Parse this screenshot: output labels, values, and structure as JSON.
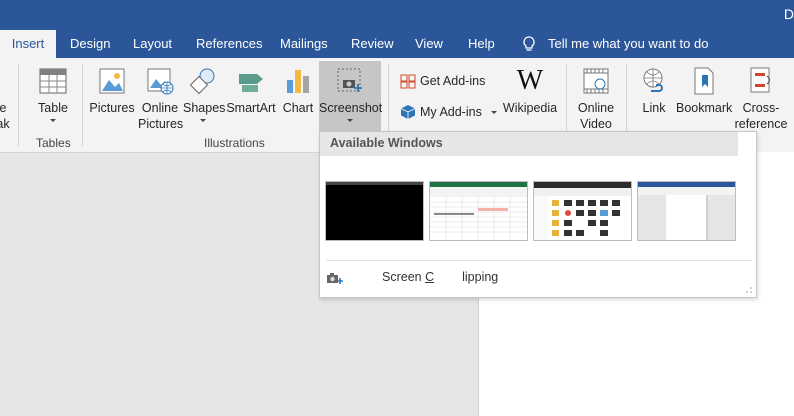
{
  "window": {
    "title_fragment": "D"
  },
  "tabs": [
    {
      "label": "Insert",
      "active": true
    },
    {
      "label": "Design"
    },
    {
      "label": "Layout"
    },
    {
      "label": "References"
    },
    {
      "label": "Mailings"
    },
    {
      "label": "Review"
    },
    {
      "label": "View"
    },
    {
      "label": "Help"
    }
  ],
  "tellme": "Tell me what you want to do",
  "ribbon": {
    "clipped_left": {
      "line1": "e",
      "line2": "ak"
    },
    "table": {
      "label": "Table"
    },
    "groups": {
      "tables": "Tables",
      "illustrations": "Illustrations"
    },
    "pictures": "Pictures",
    "online_pictures": {
      "line1": "Online",
      "line2": "Pictures"
    },
    "shapes": "Shapes",
    "smartart": "SmartArt",
    "chart": "Chart",
    "screenshot": "Screenshot",
    "get_addins": "Get Add-ins",
    "my_addins": "My Add-ins",
    "wikipedia": "Wikipedia",
    "online_video": {
      "line1": "Online",
      "line2": "Video"
    },
    "link": "Link",
    "bookmark": "Bookmark",
    "cross_reference": {
      "line1": "Cross-",
      "line2": "reference"
    }
  },
  "screenshot_menu": {
    "header": "Available Windows",
    "windows": [
      "black-window",
      "spreadsheet-window",
      "file-explorer-window",
      "document-window"
    ],
    "screen_clipping": {
      "before": "Screen ",
      "underlined": "C",
      "after": "lipping"
    }
  },
  "colors": {
    "accent": "#2b579a",
    "ribbon_bg": "#f3f3f3",
    "pressed": "#c6c6c6"
  }
}
